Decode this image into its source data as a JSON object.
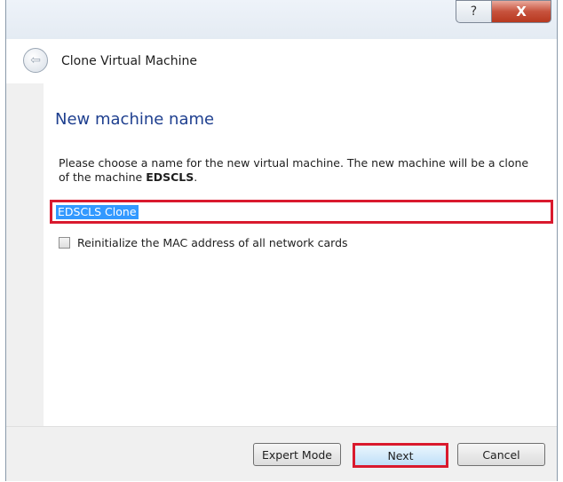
{
  "window": {
    "help_glyph": "?",
    "close_glyph": "X"
  },
  "header": {
    "back_glyph": "⇦",
    "title": "Clone Virtual Machine"
  },
  "page": {
    "title": "New machine name",
    "description_prefix": "Please choose a name for the new virtual machine. The new machine will be a clone of the machine ",
    "source_machine": "EDSCLS",
    "description_suffix": ".",
    "name_value": "EDSCLS Clone",
    "mac_checkbox_label": "Reinitialize the MAC address of all network cards",
    "mac_checkbox_checked": false
  },
  "footer": {
    "expert_mode_label": "Expert Mode",
    "next_label": "Next",
    "cancel_label": "Cancel"
  },
  "colors": {
    "highlight_border": "#d91a2e",
    "title_blue": "#1e3f8f",
    "selection": "#3399ff"
  }
}
